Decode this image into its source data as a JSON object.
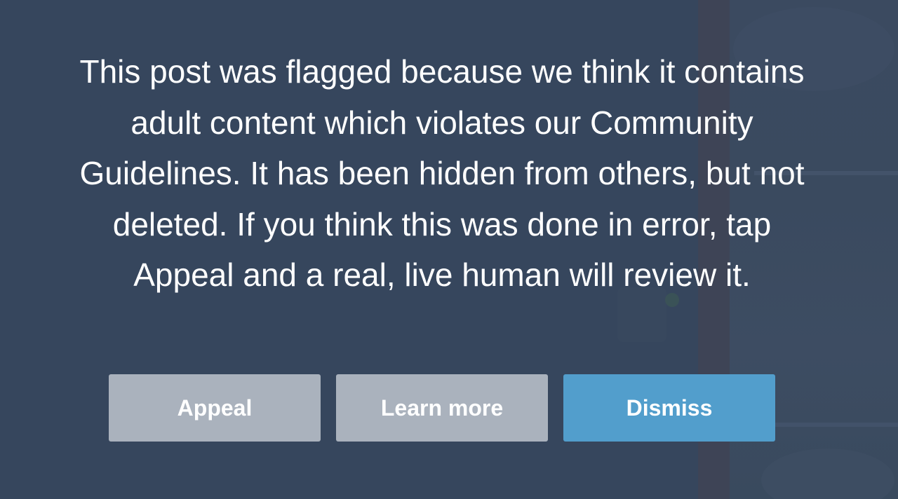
{
  "notice": {
    "text": "This post was flagged because we think it contains adult content which violates our Community Guidelines. It has been hidden from others, but not deleted. If you think this was done in error, tap Appeal and a real, live human will review it."
  },
  "actions": {
    "appeal_label": "Appeal",
    "learn_more_label": "Learn more",
    "dismiss_label": "Dismiss"
  },
  "colors": {
    "background": "#36465d",
    "secondary_button": "#aab2bd",
    "primary_button": "#529ecc",
    "text": "#ffffff"
  }
}
